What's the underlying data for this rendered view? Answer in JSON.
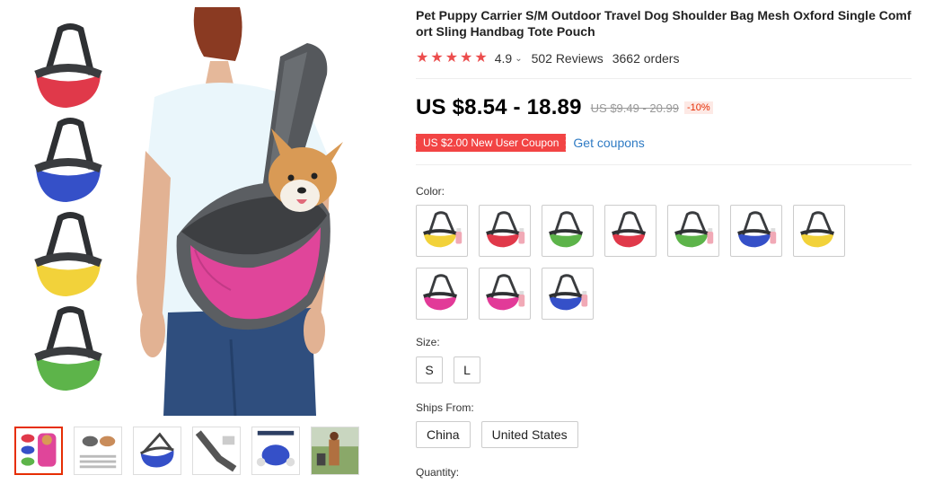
{
  "product": {
    "title": "Pet Puppy Carrier S/M Outdoor Travel Dog Shoulder Bag Mesh Oxford Single Comfort Sling Handbag Tote Pouch",
    "rating": "4.9",
    "rating_caret": "⌄",
    "reviews": "502 Reviews",
    "orders": "3662 orders",
    "price": "US $8.54 - 18.89",
    "old_price": "US $9.49 - 20.99",
    "discount": "-10%",
    "coupon": "US $2.00 New User Coupon",
    "get_coupons": "Get coupons",
    "stars": 5
  },
  "labels": {
    "color": "Color:",
    "size": "Size:",
    "ships_from": "Ships From:",
    "quantity": "Quantity:"
  },
  "sizes": [
    "S",
    "L"
  ],
  "ships_from": [
    "China",
    "United States"
  ],
  "swatches": [
    {
      "color": "#f2d23a",
      "bottle": true
    },
    {
      "color": "#e0394a",
      "bottle": true
    },
    {
      "color": "#5db44a",
      "bottle": false
    },
    {
      "color": "#e0394a",
      "bottle": false
    },
    {
      "color": "#5db44a",
      "bottle": true
    },
    {
      "color": "#3550c8",
      "bottle": true
    },
    {
      "color": "#f2d23a",
      "bottle": false
    },
    {
      "color": "#e23a98",
      "bottle": false
    },
    {
      "color": "#e23a98",
      "bottle": true
    },
    {
      "color": "#3550c8",
      "bottle": true
    }
  ],
  "gallery": {
    "side_variants": [
      "#e0394a",
      "#3550c8",
      "#f2d23a",
      "#5db44a"
    ],
    "main_bag_color": "#e0459a",
    "thumbnails": [
      "variants",
      "sizes-chart",
      "blue-bag",
      "gray-bag",
      "features",
      "outdoor-photo"
    ]
  },
  "colors": {
    "price_red": "#e62e04",
    "coupon_red": "#f24444",
    "link_blue": "#2f7bc4",
    "star_red": "#ec4d4d"
  }
}
